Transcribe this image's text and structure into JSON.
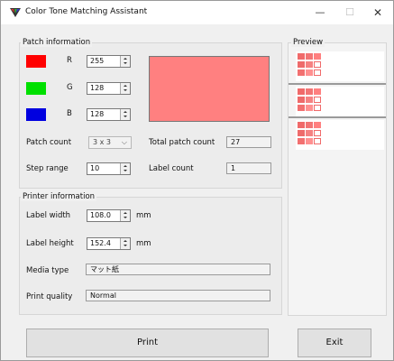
{
  "window": {
    "title": "Color Tone Matching Assistant",
    "min": "—",
    "max": "☐",
    "close": "✕"
  },
  "patch": {
    "legend": "Patch information",
    "r_label": "R",
    "g_label": "G",
    "b_label": "B",
    "r_value": "255",
    "g_value": "128",
    "b_value": "128",
    "swatch_r_color": "#ff0000",
    "swatch_g_color": "#00e000",
    "swatch_b_color": "#0000e0",
    "preview_color": "#ff8080",
    "patch_count_label": "Patch count",
    "patch_count_value": "3 x 3",
    "total_label": "Total patch count",
    "total_value": "27",
    "step_label": "Step range",
    "step_value": "10",
    "label_count_label": "Label count",
    "label_count_value": "1"
  },
  "printer": {
    "legend": "Printer information",
    "width_label": "Label width",
    "width_value": "108.0",
    "width_unit": "mm",
    "height_label": "Label height",
    "height_value": "152.4",
    "height_unit": "mm",
    "media_label": "Media type",
    "media_value": "マット紙",
    "quality_label": "Print quality",
    "quality_value": "Normal"
  },
  "preview": {
    "legend": "Preview"
  },
  "buttons": {
    "print": "Print",
    "exit": "Exit"
  }
}
